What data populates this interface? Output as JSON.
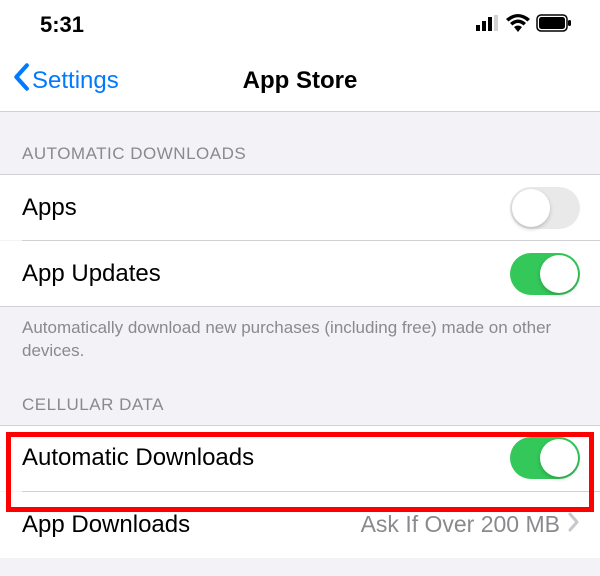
{
  "status": {
    "time": "5:31"
  },
  "nav": {
    "back": "Settings",
    "title": "App Store"
  },
  "sections": {
    "auto_downloads": {
      "header": "AUTOMATIC DOWNLOADS",
      "apps": {
        "label": "Apps",
        "on": false
      },
      "updates": {
        "label": "App Updates",
        "on": true
      },
      "footer": "Automatically download new purchases (including free) made on other devices."
    },
    "cellular": {
      "header": "CELLULAR DATA",
      "auto": {
        "label": "Automatic Downloads",
        "on": true
      },
      "app_downloads": {
        "label": "App Downloads",
        "value": "Ask If Over 200 MB"
      }
    }
  }
}
